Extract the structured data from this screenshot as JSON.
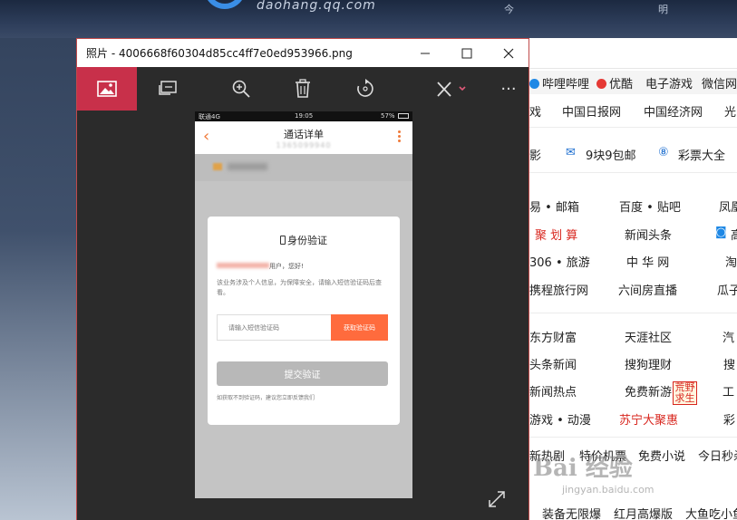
{
  "browser": {
    "domain": "daohang.qq.com",
    "header_mini": [
      "今",
      "明"
    ],
    "site_bar": [
      "哔哩哔哩",
      "优酷",
      "电子游戏",
      "微信网"
    ],
    "rows": [
      [
        "戏",
        "中国日报网",
        "中国经济网",
        "光"
      ],
      [
        "影",
        "9块9包邮",
        "彩票大全"
      ],
      [
        "易 • 邮箱",
        "百度 • 贴吧",
        "凤凰"
      ],
      [
        "聚 划 算",
        "新闻头条",
        "高"
      ],
      [
        "306 • 旅游",
        "中 华 网",
        "淘"
      ],
      [
        "携程旅行网",
        "六间房直播",
        "瓜子"
      ],
      [
        "东方财富",
        "天涯社区",
        "汽"
      ],
      [
        "头条新闻",
        "搜狗理财",
        "搜"
      ],
      [
        "新闻热点",
        "免费新游",
        "工"
      ],
      [
        "游戏 • 动漫",
        "苏宁大聚惠",
        "彩"
      ],
      [
        "新热剧",
        "特价机票",
        "免费小说",
        "今日秒杀"
      ],
      [
        "装备无限爆",
        "红月高爆版",
        "大鱼吃小鱼"
      ]
    ],
    "badge": "荒野求生",
    "watermark": "Bai 经验",
    "watermark_url": "jingyan.baidu.com"
  },
  "window": {
    "title": "照片 - 4006668f60304d85cc4ff7e0ed953966.png",
    "buttons": {
      "minimize": "—",
      "maximize": "☐",
      "close": "✕"
    }
  },
  "toolbar": {
    "more": "···"
  },
  "phone": {
    "status_left": "联通4G",
    "status_time": "19:05",
    "status_right": "57%",
    "header_title": "通话详单",
    "header_sub": "1365099940",
    "dialog": {
      "title": "身份验证",
      "greeting_suffix": "用户，您好!",
      "info": "该业务涉及个人信息，为保障安全，请输入短信验证码后查看。",
      "code_placeholder": "请输入短信验证码",
      "get_code": "获取验证码",
      "submit": "提交验证",
      "hint": "如获取不到验证码，建议您立即反馈我们"
    }
  },
  "colors": {
    "accent": "#c8304a",
    "orange": "#ff6b3d"
  }
}
